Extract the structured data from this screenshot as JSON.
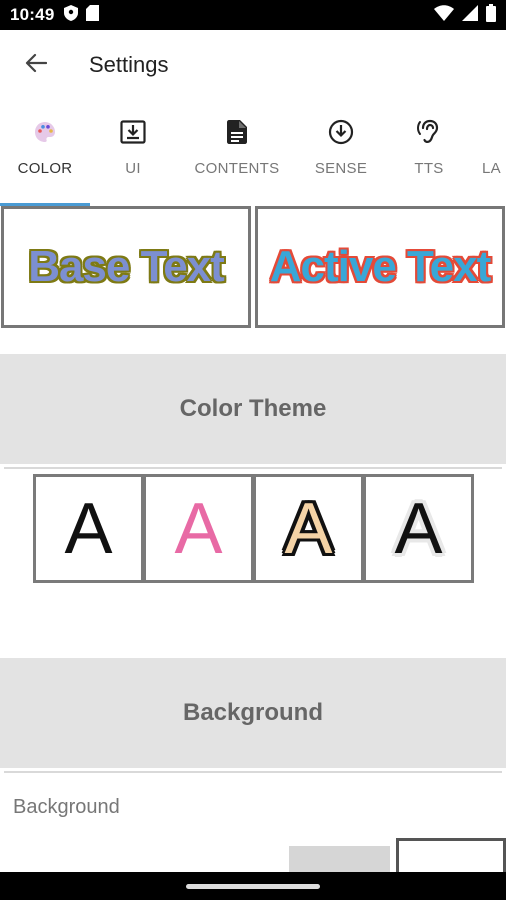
{
  "status_bar": {
    "time": "10:49",
    "left_icons": [
      "shield-icon",
      "sd-card-icon"
    ],
    "right_icons": [
      "wifi-icon",
      "signal-icon",
      "battery-icon"
    ]
  },
  "app_bar": {
    "title": "Settings",
    "back_icon": "arrow-left-icon"
  },
  "tabs": [
    {
      "label": "COLOR",
      "icon": "palette-icon",
      "active": true
    },
    {
      "label": "UI",
      "icon": "download-box-icon",
      "active": false
    },
    {
      "label": "CONTENTS",
      "icon": "document-icon",
      "active": false
    },
    {
      "label": "SENSE",
      "icon": "arrow-down-circle-icon",
      "active": false
    },
    {
      "label": "TTS",
      "icon": "hearing-icon",
      "active": false
    },
    {
      "label": "LA",
      "icon": "",
      "active": false
    }
  ],
  "preview": {
    "base_text": "Base Text",
    "active_text": "Active Text",
    "colors": {
      "base_fill": "#7c8fd1",
      "base_outline": "#7e7a14",
      "active_fill": "#39a7d7",
      "active_outline": "#e44a38"
    }
  },
  "sections": {
    "color_theme": "Color Theme",
    "background": "Background"
  },
  "themes": [
    {
      "letter": "A",
      "fill": "#111111"
    },
    {
      "letter": "A",
      "fill": "#e86aa5"
    },
    {
      "letter": "A",
      "fill": "#f4d3a6",
      "outline": "#111111"
    },
    {
      "letter": "A",
      "fill": "#111111",
      "outline": "#e8e8e8"
    }
  ],
  "background_setting": {
    "label": "Background"
  },
  "accent_color": "#4a9bd4"
}
